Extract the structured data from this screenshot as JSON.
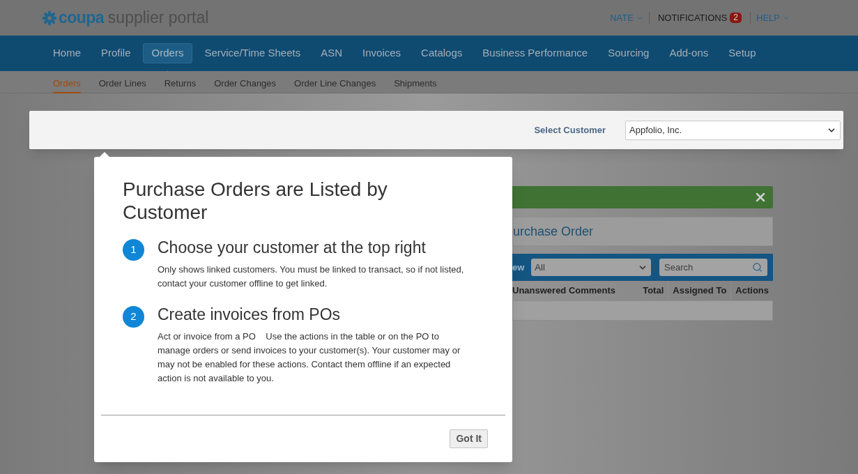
{
  "header": {
    "logo_brand": "coupa",
    "logo_product": "supplier portal",
    "user_menu": "NATE",
    "notifications": {
      "label": "NOTIFICATIONS",
      "count": "2"
    },
    "help_menu": "HELP"
  },
  "nav": [
    {
      "label": "Home",
      "selected": false
    },
    {
      "label": "Profile",
      "selected": false
    },
    {
      "label": "Orders",
      "selected": true
    },
    {
      "label": "Service/Time Sheets",
      "selected": false
    },
    {
      "label": "ASN",
      "selected": false
    },
    {
      "label": "Invoices",
      "selected": false
    },
    {
      "label": "Catalogs",
      "selected": false
    },
    {
      "label": "Business Performance",
      "selected": false
    },
    {
      "label": "Sourcing",
      "selected": false
    },
    {
      "label": "Add-ons",
      "selected": false
    },
    {
      "label": "Setup",
      "selected": false
    }
  ],
  "subnav": [
    {
      "label": "Orders",
      "selected": true
    },
    {
      "label": "Order Lines",
      "selected": false
    },
    {
      "label": "Returns",
      "selected": false
    },
    {
      "label": "Order Changes",
      "selected": false
    },
    {
      "label": "Order Line Changes",
      "selected": false
    },
    {
      "label": "Shipments",
      "selected": false
    }
  ],
  "customer_bar": {
    "label": "Select Customer",
    "value": "Appfolio, Inc."
  },
  "background": {
    "panel_title": "urchase Order",
    "view_label": "ew",
    "view_value": "All",
    "search": {
      "placeholder": "Search"
    },
    "columns": [
      "Unanswered Comments",
      "Total",
      "Assigned To",
      "Actions"
    ]
  },
  "popover": {
    "title": "Purchase Orders are Listed by Customer",
    "steps": [
      {
        "number": "1",
        "heading": "Choose your customer at the top right",
        "text": "Only shows linked customers. You must be linked to transact, so if not listed, contact your customer offline to get linked."
      },
      {
        "number": "2",
        "heading": "Create invoices from POs",
        "text": "Act or invoice from a PO    Use the actions in the table or on the PO to manage orders or send invoices to your customer(s). Your customer may or may not be enabled for these actions. Contact them offline if an expected action is not available to you."
      }
    ],
    "button": "Got It"
  }
}
